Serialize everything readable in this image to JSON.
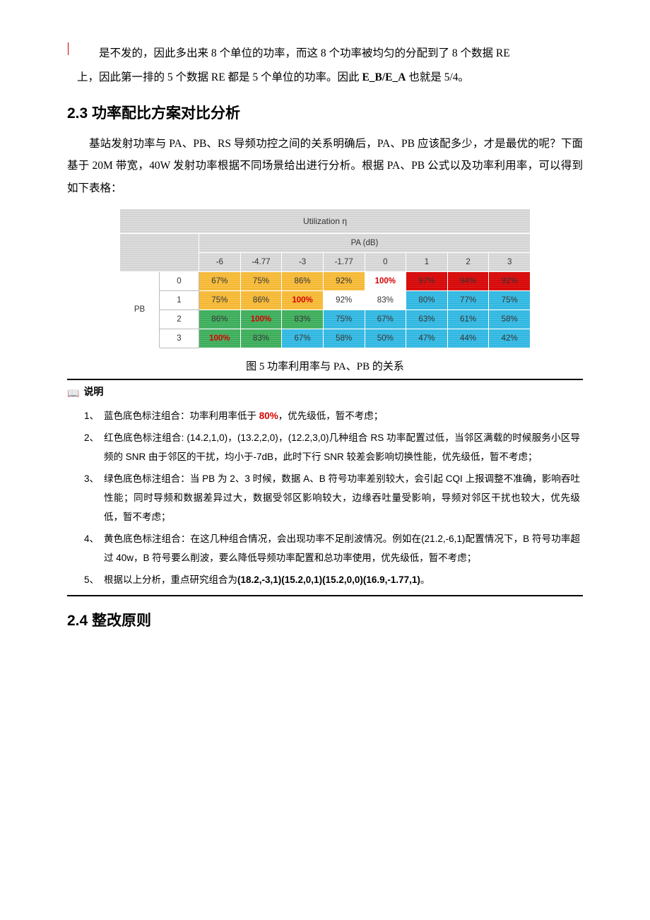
{
  "intro": {
    "p1_a": "是不发的，因此多出来 8 个单位的功率，而这 8 个功率被均匀的分配到了 8 个数据 RE",
    "p1_b": "上，因此第一排的 5 个数据 RE 都是 5 个单位的功率。因此 ",
    "p1_bold": "E_B/E_A",
    "p1_c": " 也就是 5/4。"
  },
  "h23": "2.3 功率配比方案对比分析",
  "sec23": {
    "p1": "基站发射功率与 PA、PB、RS 导频功控之间的关系明确后，PA、PB 应该配多少，才是最优的呢？下面基于 20M 带宽，40W 发射功率根据不同场景给出进行分析。根据 PA、PB 公式以及功率利用率，可以得到如下表格："
  },
  "table": {
    "title": "Utilization η",
    "col_title": "PA (dB)",
    "row_title": "PB",
    "cols": [
      "-6",
      "-4.77",
      "-3",
      "-1.77",
      "0",
      "1",
      "2",
      "3"
    ],
    "rows": [
      "0",
      "1",
      "2",
      "3"
    ],
    "cells": [
      [
        {
          "v": "67%",
          "c": "yellow"
        },
        {
          "v": "75%",
          "c": "yellow"
        },
        {
          "v": "86%",
          "c": "yellow"
        },
        {
          "v": "92%",
          "c": "yellow"
        },
        {
          "v": "100%",
          "c": "white",
          "hl": true
        },
        {
          "v": "97%",
          "c": "red"
        },
        {
          "v": "94%",
          "c": "red"
        },
        {
          "v": "92%",
          "c": "red"
        }
      ],
      [
        {
          "v": "75%",
          "c": "yellow"
        },
        {
          "v": "86%",
          "c": "yellow"
        },
        {
          "v": "100%",
          "c": "yellow",
          "hl": true
        },
        {
          "v": "92%",
          "c": "white"
        },
        {
          "v": "83%",
          "c": "white"
        },
        {
          "v": "80%",
          "c": "blue"
        },
        {
          "v": "77%",
          "c": "blue"
        },
        {
          "v": "75%",
          "c": "blue"
        }
      ],
      [
        {
          "v": "86%",
          "c": "green"
        },
        {
          "v": "100%",
          "c": "green",
          "hl": true
        },
        {
          "v": "83%",
          "c": "green"
        },
        {
          "v": "75%",
          "c": "blue"
        },
        {
          "v": "67%",
          "c": "blue"
        },
        {
          "v": "63%",
          "c": "blue"
        },
        {
          "v": "61%",
          "c": "blue"
        },
        {
          "v": "58%",
          "c": "blue"
        }
      ],
      [
        {
          "v": "100%",
          "c": "green",
          "hl": true
        },
        {
          "v": "83%",
          "c": "green"
        },
        {
          "v": "67%",
          "c": "blue"
        },
        {
          "v": "58%",
          "c": "blue"
        },
        {
          "v": "50%",
          "c": "blue"
        },
        {
          "v": "47%",
          "c": "blue"
        },
        {
          "v": "44%",
          "c": "blue"
        },
        {
          "v": "42%",
          "c": "blue"
        }
      ]
    ]
  },
  "figcap": "图 5  功率利用率与 PA、PB 的关系",
  "note_icon": "📖",
  "note_title": "说明",
  "notes": {
    "n1_a": "蓝色底色标注组合：功率利用率低于 ",
    "n1_red": "80%",
    "n1_b": "，优先级低，暂不考虑；",
    "n2": "红色底色标注组合: (14.2,1,0)，(13.2,2,0)，(12.2,3,0)几种组合 RS 功率配置过低，当邻区满载的时候服务小区导频的 SNR 由于邻区的干扰，均小于-7dB，此时下行 SNR 较差会影响切换性能，优先级低，暂不考虑；",
    "n3": "绿色底色标注组合：当 PB 为 2、3 时候，数据 A、B 符号功率差别较大，会引起 CQI 上报调整不准确，影响吞吐性能；同时导频和数据差异过大，数据受邻区影响较大，边缘吞吐量受影响，导频对邻区干扰也较大，优先级低，暂不考虑；",
    "n4": "黄色底色标注组合：在这几种组合情况，会出现功率不足削波情况。例如在(21.2,-6,1)配置情况下，B 符号功率超过 40w，B 符号要么削波，要么降低导频功率配置和总功率使用，优先级低，暂不考虑；",
    "n5_a": "根据以上分析，重点研究组合为",
    "n5_bold": "(18.2,-3,1)(15.2,0,1)(15.2,0,0)(16.9,-1.77,1)",
    "n5_b": "。"
  },
  "h24": "2.4  整改原则",
  "chart_data": {
    "type": "table",
    "title": "Utilization η",
    "xlabel": "PA (dB)",
    "ylabel": "PB",
    "x": [
      "-6",
      "-4.77",
      "-3",
      "-1.77",
      "0",
      "1",
      "2",
      "3"
    ],
    "y": [
      "0",
      "1",
      "2",
      "3"
    ],
    "values": [
      [
        "67%",
        "75%",
        "86%",
        "92%",
        "100%",
        "97%",
        "94%",
        "92%"
      ],
      [
        "75%",
        "86%",
        "100%",
        "92%",
        "83%",
        "80%",
        "77%",
        "75%"
      ],
      [
        "86%",
        "100%",
        "83%",
        "75%",
        "67%",
        "63%",
        "61%",
        "58%"
      ],
      [
        "100%",
        "83%",
        "67%",
        "58%",
        "50%",
        "47%",
        "44%",
        "42%"
      ]
    ],
    "cell_category": [
      [
        "yellow",
        "yellow",
        "yellow",
        "yellow",
        "white",
        "red",
        "red",
        "red"
      ],
      [
        "yellow",
        "yellow",
        "yellow",
        "white",
        "white",
        "blue",
        "blue",
        "blue"
      ],
      [
        "green",
        "green",
        "green",
        "blue",
        "blue",
        "blue",
        "blue",
        "blue"
      ],
      [
        "green",
        "green",
        "blue",
        "blue",
        "blue",
        "blue",
        "blue",
        "blue"
      ]
    ],
    "legend": {
      "blue": "功率利用率低于80%，优先级低",
      "red": "RS功率配置过低，下行SNR较差",
      "green": "PB为2/3时功率差异大，CQI不准",
      "yellow": "功率不足削波",
      "white": "候选组合"
    }
  }
}
